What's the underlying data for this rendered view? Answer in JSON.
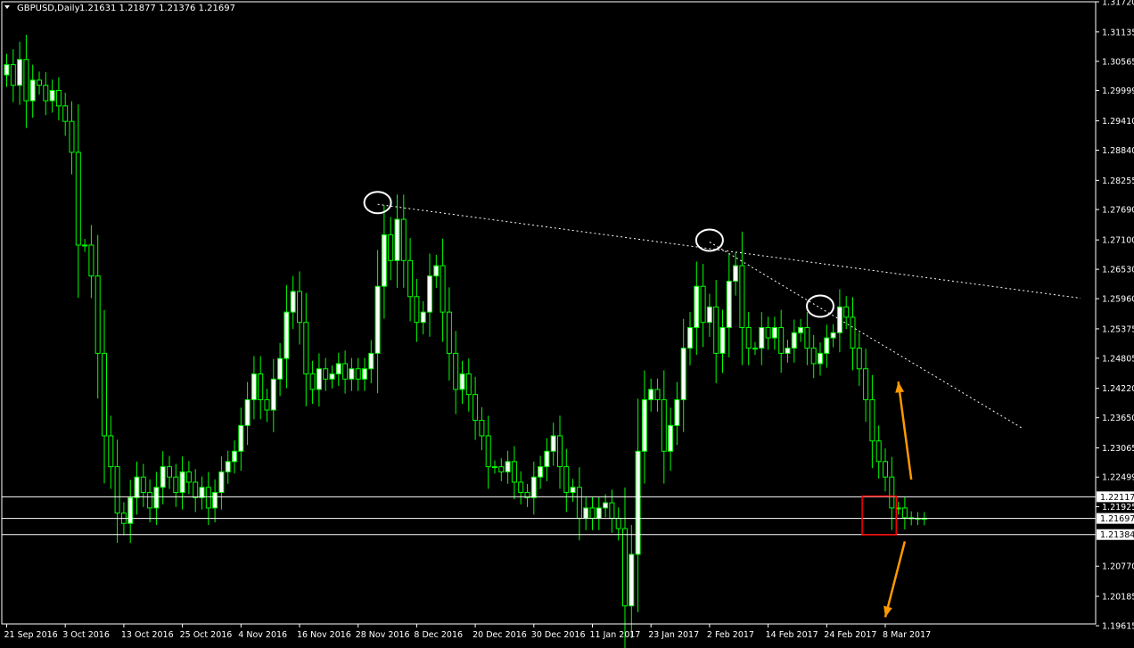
{
  "header": {
    "symbol_timeframe": "GBPUSD,Daily",
    "ohlc": "1.21631 1.21877 1.21376 1.21697"
  },
  "colors": {
    "background": "#000000",
    "axis": "#ffffff",
    "bull_candle": "#ffffff",
    "candle_outline": "#00ff00",
    "level_line": "#ffffff",
    "arrow": "#ff9900",
    "highlight_box": "#ff0000"
  },
  "chart_data": {
    "type": "candlestick",
    "symbol": "GBPUSD",
    "timeframe": "Daily",
    "ylim": [
      1.1965,
      1.3172
    ],
    "y_ticks": [
      "1.31720",
      "1.31135",
      "1.30565",
      "1.29999",
      "1.29410",
      "1.28840",
      "1.28255",
      "1.27690",
      "1.27100",
      "1.26530",
      "1.25960",
      "1.25375",
      "1.24805",
      "1.24220",
      "1.23650",
      "1.23065",
      "1.22499",
      "1.21925",
      "1.20770",
      "1.20185",
      "1.19615"
    ],
    "x_ticks": [
      {
        "i": 0,
        "label": "21 Sep 2016"
      },
      {
        "i": 9,
        "label": "3 Oct 2016"
      },
      {
        "i": 18,
        "label": "13 Oct 2016"
      },
      {
        "i": 27,
        "label": "25 Oct 2016"
      },
      {
        "i": 36,
        "label": "4 Nov 2016"
      },
      {
        "i": 45,
        "label": "16 Nov 2016"
      },
      {
        "i": 54,
        "label": "28 Nov 2016"
      },
      {
        "i": 63,
        "label": "8 Dec 2016"
      },
      {
        "i": 72,
        "label": "20 Dec 2016"
      },
      {
        "i": 81,
        "label": "30 Dec 2016"
      },
      {
        "i": 90,
        "label": "11 Jan 2017"
      },
      {
        "i": 99,
        "label": "23 Jan 2017"
      },
      {
        "i": 108,
        "label": "2 Feb 2017"
      },
      {
        "i": 117,
        "label": "14 Feb 2017"
      },
      {
        "i": 126,
        "label": "24 Feb 2017"
      },
      {
        "i": 135,
        "label": "8 Mar 2017"
      }
    ],
    "closes": [
      1.305,
      1.301,
      1.306,
      1.298,
      1.302,
      1.301,
      1.298,
      1.3,
      1.297,
      1.294,
      1.288,
      1.27,
      1.27,
      1.264,
      1.249,
      1.233,
      1.227,
      1.218,
      1.216,
      1.221,
      1.225,
      1.222,
      1.219,
      1.223,
      1.227,
      1.225,
      1.222,
      1.226,
      1.224,
      1.221,
      1.223,
      1.219,
      1.222,
      1.226,
      1.228,
      1.23,
      1.235,
      1.24,
      1.245,
      1.24,
      1.238,
      1.244,
      1.248,
      1.257,
      1.261,
      1.255,
      1.245,
      1.242,
      1.246,
      1.244,
      1.245,
      1.247,
      1.244,
      1.246,
      1.244,
      1.246,
      1.249,
      1.262,
      1.272,
      1.267,
      1.275,
      1.267,
      1.26,
      1.255,
      1.257,
      1.264,
      1.266,
      1.257,
      1.249,
      1.242,
      1.245,
      1.241,
      1.236,
      1.233,
      1.227,
      1.227,
      1.226,
      1.228,
      1.224,
      1.222,
      1.221,
      1.225,
      1.227,
      1.23,
      1.233,
      1.227,
      1.222,
      1.223,
      1.217,
      1.219,
      1.217,
      1.219,
      1.22,
      1.217,
      1.215,
      1.2,
      1.21,
      1.23,
      1.24,
      1.242,
      1.24,
      1.23,
      1.235,
      1.24,
      1.25,
      1.254,
      1.262,
      1.255,
      1.258,
      1.249,
      1.254,
      1.263,
      1.266,
      1.254,
      1.25,
      1.25,
      1.254,
      1.252,
      1.254,
      1.249,
      1.25,
      1.253,
      1.254,
      1.25,
      1.247,
      1.249,
      1.252,
      1.253,
      1.258,
      1.256,
      1.25,
      1.246,
      1.24,
      1.232,
      1.228,
      1.225,
      1.219,
      1.219,
      1.2171,
      1.217,
      1.217,
      1.21697
    ],
    "annotations": {
      "swing_highs": [
        {
          "i": 57,
          "price": 1.2779
        },
        {
          "i": 108,
          "price": 1.2706
        },
        {
          "i": 125,
          "price": 1.2578
        }
      ],
      "trendlines": [
        {
          "from": {
            "i": 57,
            "price": 1.2779
          },
          "to": {
            "i": 165,
            "price": 1.2597
          }
        },
        {
          "from": {
            "i": 108,
            "price": 1.2706
          },
          "to": {
            "i": 156,
            "price": 1.2345
          }
        }
      ],
      "levels": [
        1.22117,
        1.21697,
        1.21384
      ],
      "level_labels": [
        "1.22117",
        "1.21697",
        "1.21384"
      ],
      "arrows": [
        {
          "from": {
            "i": 139,
            "price": 1.2245
          },
          "to": {
            "i": 137,
            "price": 1.2435
          }
        },
        {
          "from": {
            "i": 138,
            "price": 1.2125
          },
          "to": {
            "i": 135,
            "price": 1.1978
          }
        }
      ],
      "highlight_box": {
        "i_from": 132,
        "i_to": 136,
        "price_top": 1.2213,
        "price_bottom": 1.2138
      }
    }
  }
}
